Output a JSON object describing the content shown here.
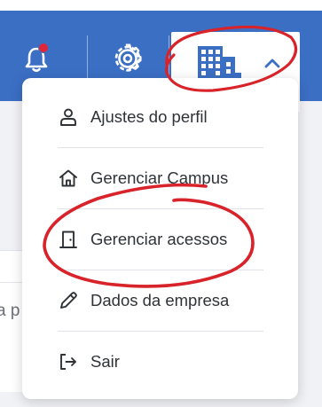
{
  "header": {
    "notification_icon": "bell-icon",
    "settings_icon": "gear-icon",
    "company_icon": "building-icon",
    "expand_icon": "chevron-up-icon",
    "bar_color": "#3b6fc4",
    "badge_color": "#e0263a"
  },
  "menu": {
    "items": [
      {
        "label": "Ajustes do perfil",
        "icon": "user-icon"
      },
      {
        "label": "Gerenciar Campus",
        "icon": "home-icon"
      },
      {
        "label": "Gerenciar acessos",
        "icon": "door-icon"
      },
      {
        "label": "Dados da empresa",
        "icon": "pencil-icon"
      },
      {
        "label": "Sair",
        "icon": "logout-icon"
      }
    ]
  },
  "background": {
    "partial_text": "a p"
  },
  "annotation": {
    "marker_color": "#d8232a"
  }
}
